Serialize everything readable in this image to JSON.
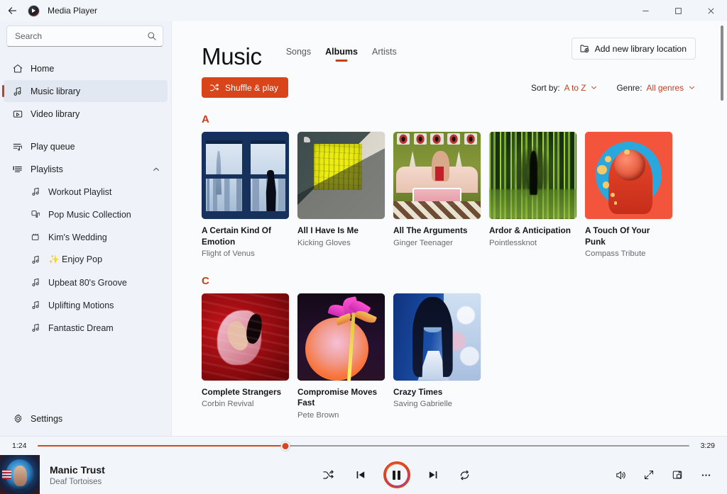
{
  "window": {
    "title": "Media Player",
    "back_label": "Back",
    "minimize_label": "Minimize",
    "maximize_label": "Maximize",
    "close_label": "Close"
  },
  "accent": "#c4401b",
  "accent_button": "#d9451b",
  "search": {
    "value": "",
    "placeholder": "Search"
  },
  "sidebar": {
    "items": [
      {
        "label": "Home",
        "icon": "home-icon",
        "active": false
      },
      {
        "label": "Music library",
        "icon": "music-note-icon",
        "active": true
      },
      {
        "label": "Video library",
        "icon": "video-icon",
        "active": false
      }
    ],
    "queue": {
      "label": "Play queue",
      "icon": "play-queue-icon"
    },
    "playlists_header": {
      "label": "Playlists",
      "icon": "playlist-icon",
      "chevron": "chevron-up-icon"
    },
    "playlists": [
      {
        "label": "Workout Playlist",
        "icon": "music-note-icon"
      },
      {
        "label": "Pop Music Collection",
        "icon": "playlist-music-icon"
      },
      {
        "label": "Kim's Wedding",
        "icon": "video-clip-icon"
      },
      {
        "label": "✨ Enjoy Pop",
        "icon": "music-note-icon"
      },
      {
        "label": "Upbeat 80's Groove",
        "icon": "music-note-icon"
      },
      {
        "label": "Uplifting Motions",
        "icon": "music-note-icon"
      },
      {
        "label": "Fantastic Dream",
        "icon": "music-note-icon"
      }
    ],
    "settings": {
      "label": "Settings",
      "icon": "gear-icon"
    }
  },
  "main": {
    "page_title": "Music",
    "tabs": [
      {
        "label": "Songs",
        "active": false
      },
      {
        "label": "Albums",
        "active": true
      },
      {
        "label": "Artists",
        "active": false
      }
    ],
    "add_library_button": {
      "label": "Add new library location",
      "icon": "folder-add-icon"
    },
    "shuffle_button": {
      "label": "Shuffle & play",
      "icon": "shuffle-icon"
    },
    "sort": {
      "label": "Sort by:",
      "value": "A to Z"
    },
    "genre": {
      "label": "Genre:",
      "value": "All genres"
    },
    "sections": [
      {
        "letter": "A",
        "albums": [
          {
            "title": "A Certain Kind Of Emotion",
            "artist": "Flight of Venus",
            "art": "art-window"
          },
          {
            "title": "All I Have Is Me",
            "artist": "Kicking Gloves",
            "art": "art-yellow"
          },
          {
            "title": "All The Arguments",
            "artist": "Ginger Teenager",
            "art": "art-green"
          },
          {
            "title": "Ardor & Anticipation",
            "artist": "Pointlessknot",
            "art": "art-corridor"
          },
          {
            "title": "A Touch Of Your Punk",
            "artist": "Compass Tribute",
            "art": "art-astro"
          }
        ]
      },
      {
        "letter": "C",
        "albums": [
          {
            "title": "Complete Strangers",
            "artist": "Corbin Revival",
            "art": "art-red"
          },
          {
            "title": "Compromise Moves Fast",
            "artist": "Pete Brown",
            "art": "art-palm"
          },
          {
            "title": "Crazy Times",
            "artist": "Saving Gabrielle",
            "art": "art-blue"
          }
        ]
      }
    ]
  },
  "player": {
    "elapsed": "1:24",
    "duration": "3:29",
    "progress_percent": 38,
    "now_playing": {
      "title": "Manic Trust",
      "artist": "Deaf Tortoises"
    },
    "controls": {
      "shuffle": "shuffle-icon",
      "previous": "previous-track-icon",
      "play_pause": "pause-icon",
      "next": "next-track-icon",
      "repeat": "repeat-icon",
      "volume": "volume-icon",
      "fullscreen": "expand-icon",
      "miniplayer": "mini-player-icon",
      "more": "more-options-icon"
    }
  }
}
